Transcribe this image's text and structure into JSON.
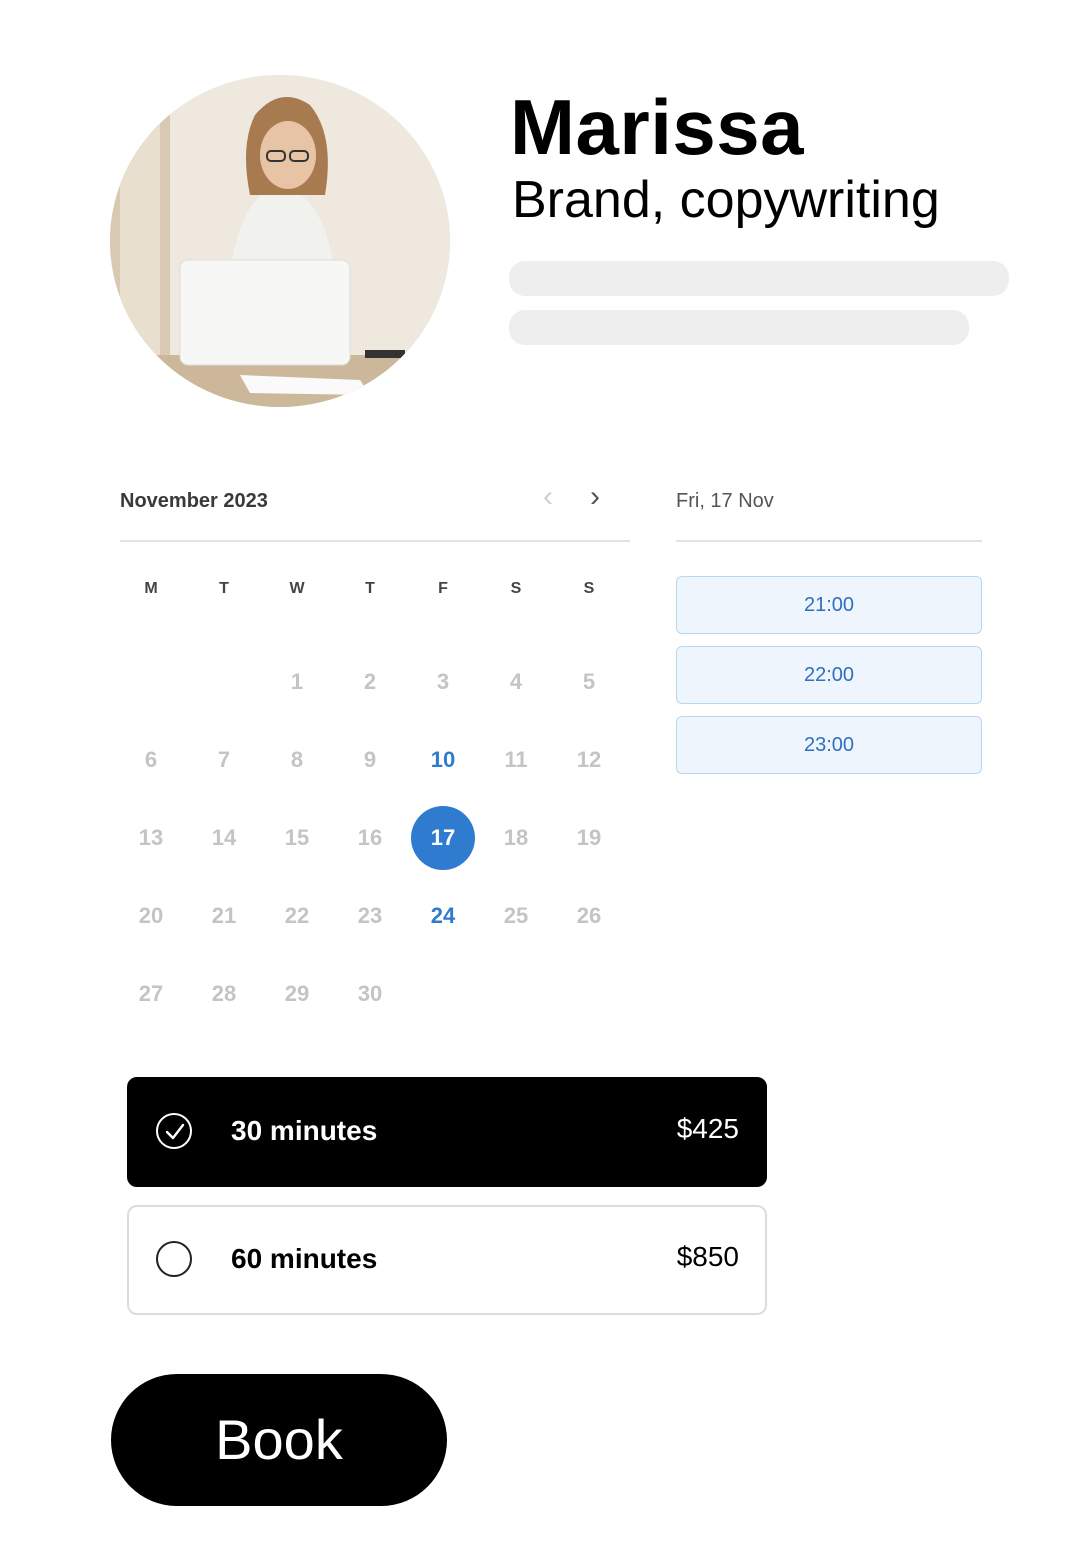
{
  "profile": {
    "name": "Marissa",
    "subtitle": "Brand, copywriting"
  },
  "calendar": {
    "month_label": "November 2023",
    "prev_icon": "chevron-left-icon",
    "next_icon": "chevron-right-icon",
    "weekdays": [
      "M",
      "T",
      "W",
      "T",
      "F",
      "S",
      "S"
    ],
    "weeks": [
      [
        "",
        "",
        "1",
        "2",
        "3",
        "4",
        "5"
      ],
      [
        "6",
        "7",
        "8",
        "9",
        "10",
        "11",
        "12"
      ],
      [
        "13",
        "14",
        "15",
        "16",
        "17",
        "18",
        "19"
      ],
      [
        "20",
        "21",
        "22",
        "23",
        "24",
        "25",
        "26"
      ],
      [
        "27",
        "28",
        "29",
        "30",
        "",
        "",
        ""
      ]
    ],
    "available_days": [
      "10",
      "24"
    ],
    "selected_day": "17",
    "accent_color": "#2f7bd0"
  },
  "schedule": {
    "selected_date_label": "Fri, 17 Nov",
    "slots": [
      "21:00",
      "22:00",
      "23:00"
    ]
  },
  "durations": [
    {
      "label": "30 minutes",
      "price": "$425",
      "selected": true
    },
    {
      "label": "60 minutes",
      "price": "$850",
      "selected": false
    }
  ],
  "book_button": {
    "label": "Book"
  }
}
